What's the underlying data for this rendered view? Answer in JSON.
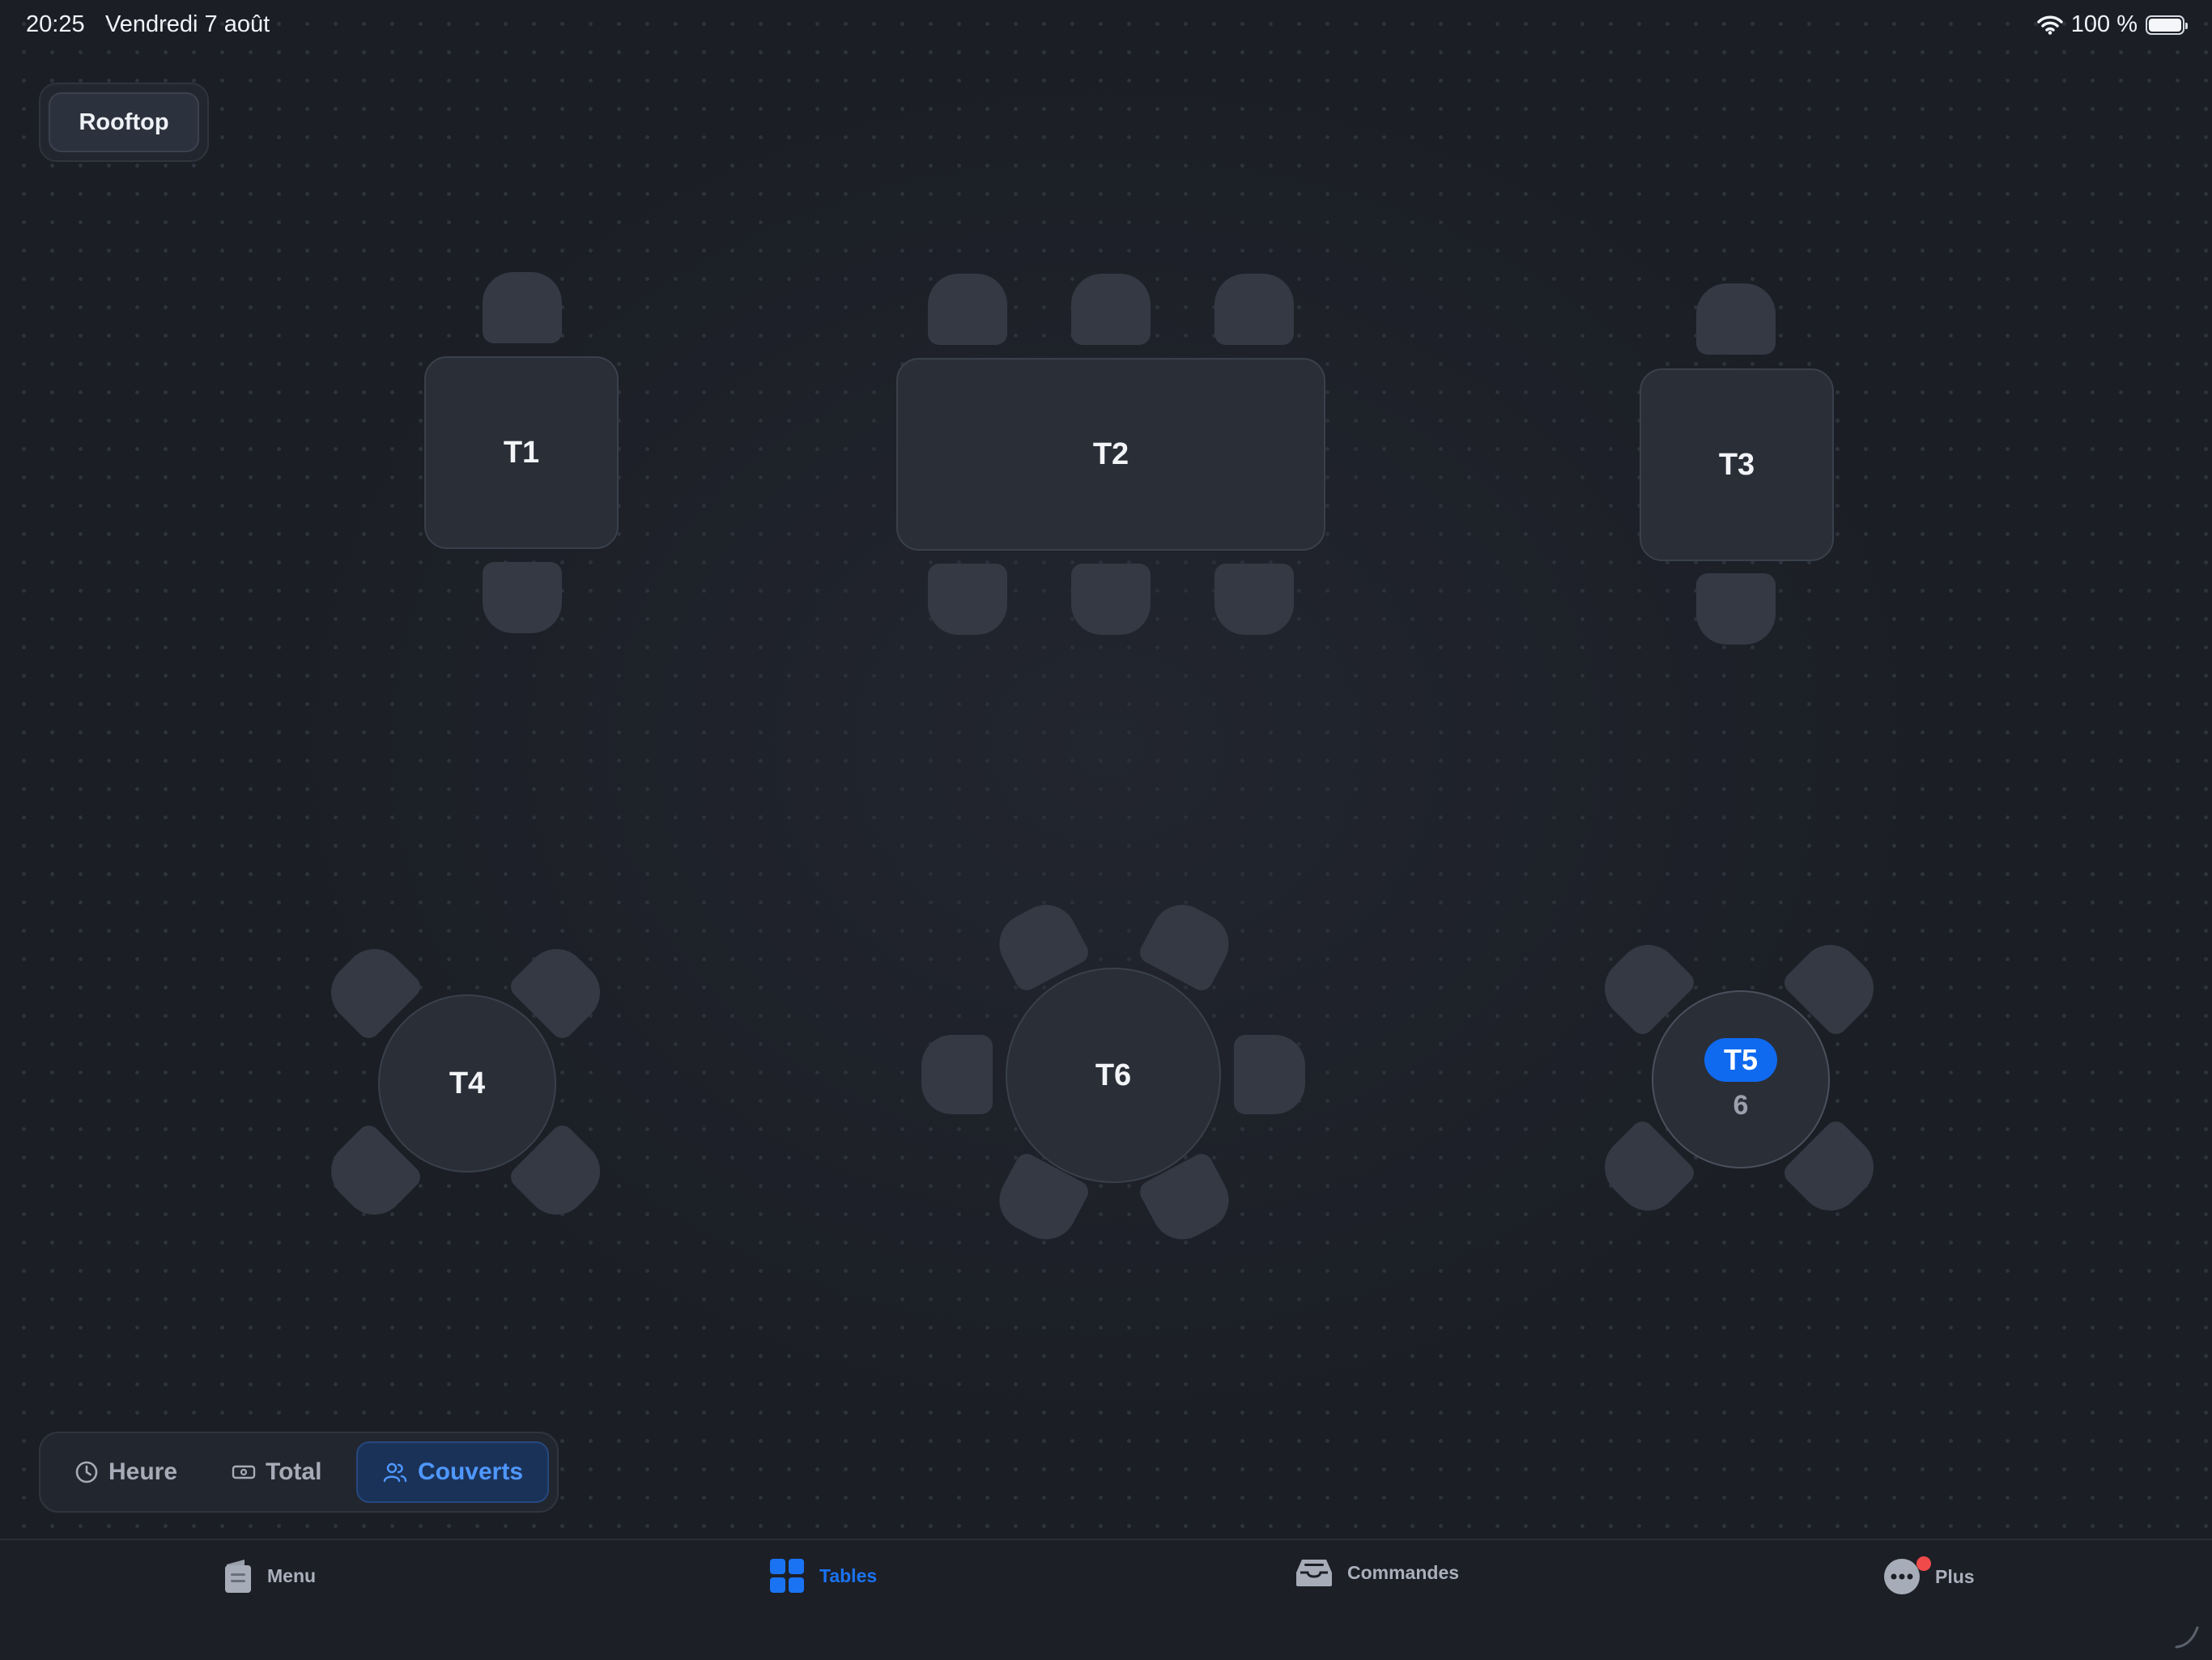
{
  "status_bar": {
    "time": "20:25",
    "date": "Vendredi 7 août",
    "battery": "100 %"
  },
  "area": {
    "label": "Rooftop"
  },
  "tables": [
    {
      "id": "T1",
      "shape": "rect",
      "seats": 2
    },
    {
      "id": "T2",
      "shape": "rect",
      "seats": 6
    },
    {
      "id": "T3",
      "shape": "rect",
      "seats": 2
    },
    {
      "id": "T4",
      "shape": "round",
      "seats": 4
    },
    {
      "id": "T6",
      "shape": "round",
      "seats": 6
    },
    {
      "id": "T5",
      "shape": "round",
      "seats": 4,
      "selected": true,
      "covers": "6"
    }
  ],
  "display_modes": {
    "items": [
      {
        "label": "Heure",
        "icon": "clock-icon"
      },
      {
        "label": "Total",
        "icon": "banknote-icon"
      },
      {
        "label": "Couverts",
        "icon": "users-icon",
        "active": true
      }
    ]
  },
  "tab_bar": {
    "items": [
      {
        "label": "Menu",
        "icon": "menu-book-icon"
      },
      {
        "label": "Tables",
        "icon": "grid-icon",
        "active": true
      },
      {
        "label": "Commandes",
        "icon": "inbox-tray-icon"
      },
      {
        "label": "Plus",
        "icon": "more-dots-icon",
        "notification": true
      }
    ]
  },
  "colors": {
    "accent": "#1a73f2",
    "background": "#1b1e25",
    "table": "#2a2e37",
    "seat": "#343944",
    "notification": "#f04a4a"
  }
}
